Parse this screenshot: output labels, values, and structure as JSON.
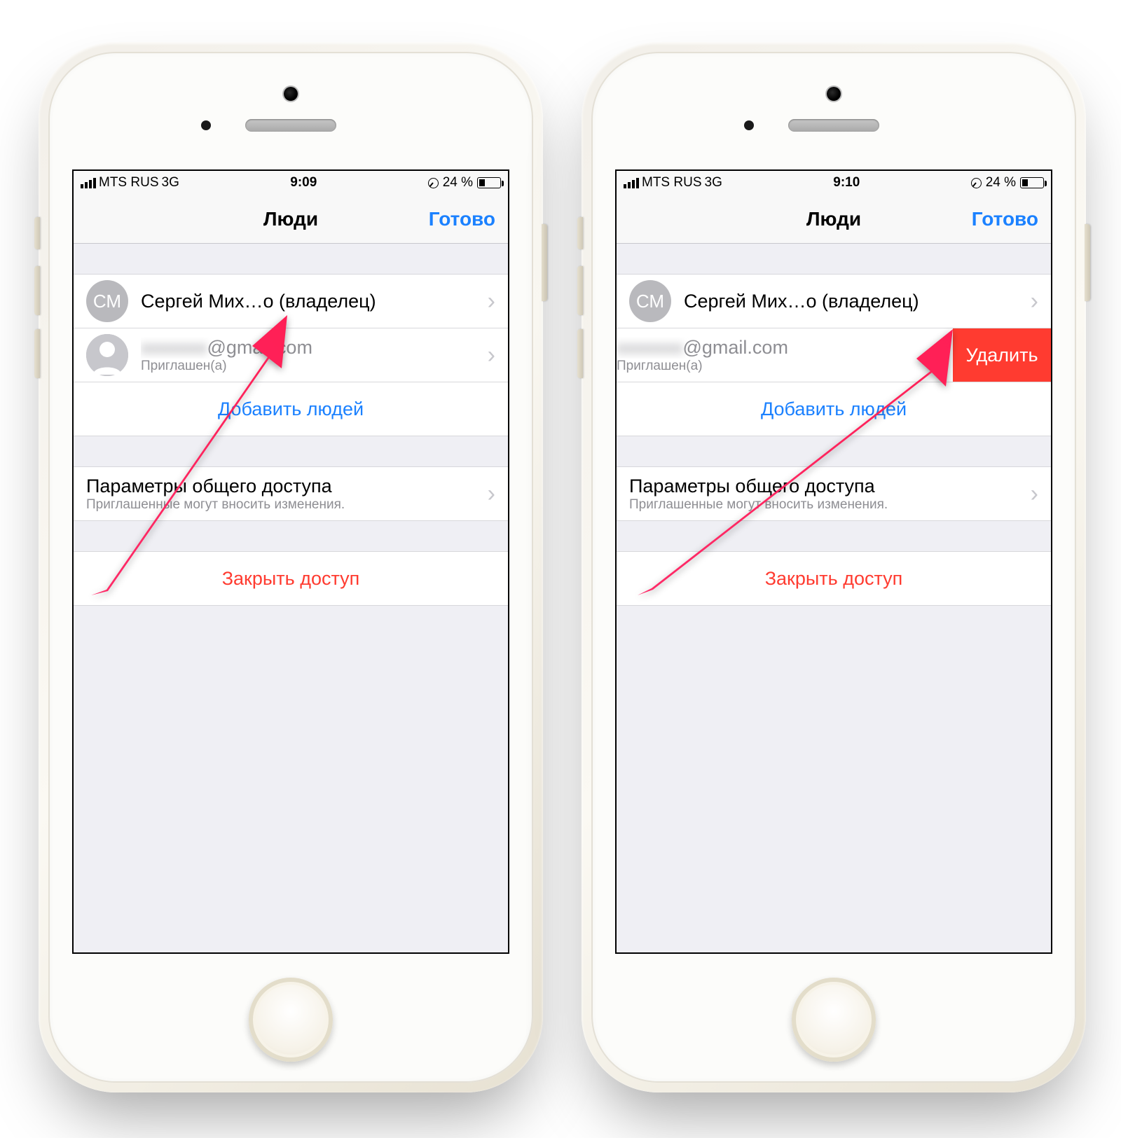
{
  "status": {
    "carrier": "MTS RUS",
    "network": "3G",
    "time_left": "9:09",
    "time_right": "9:10",
    "battery": "24 %"
  },
  "nav": {
    "title": "Люди",
    "done": "Готово"
  },
  "people": {
    "owner_initials": "СМ",
    "owner_name": "Сергей Мих…о (владелец)",
    "invitee_email_hidden": "xxxxxxx",
    "invitee_email_domain": "@gmail.com",
    "invitee_status": "Приглашен(а)",
    "add": "Добавить людей"
  },
  "sharing": {
    "title": "Параметры общего доступа",
    "sub": "Приглашенные могут вносить изменения."
  },
  "actions": {
    "close": "Закрыть доступ",
    "delete": "Удалить"
  }
}
